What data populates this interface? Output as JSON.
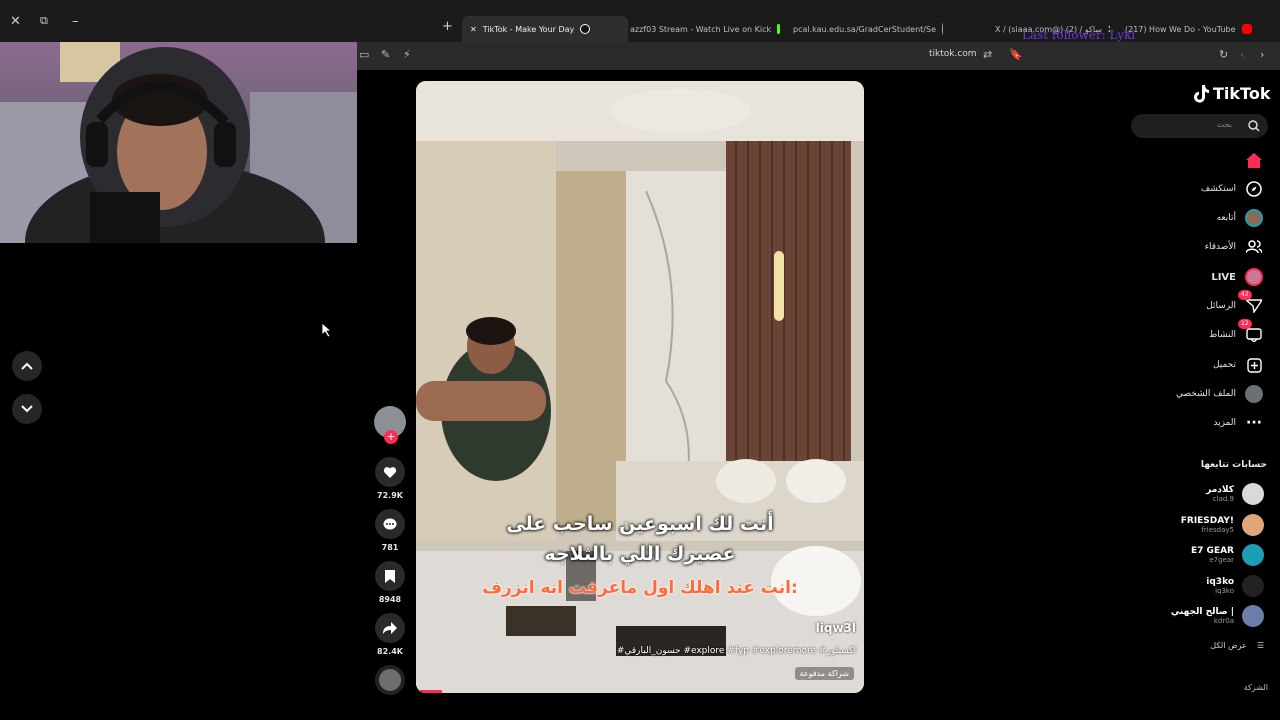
{
  "browser": {
    "tabs": [
      {
        "label": "TikTok - Make Your Day",
        "active": true
      },
      {
        "label": "azzf03 Stream - Watch Live on Kick",
        "active": false
      },
      {
        "label": "pcal.kau.edu.sa/GradCerStudent/Se",
        "active": false
      },
      {
        "label": "X / (siaaa.com@) ساكو / (2)",
        "active": false
      },
      {
        "label": "(217) How We Do - YouTube",
        "active": false
      }
    ],
    "url": "tiktok.com"
  },
  "overlay": {
    "text": "Last follower: Lyki"
  },
  "video": {
    "subtitle_line1": "أنت لك اسبوعين ساحب على",
    "subtitle_line2": "عصيرك اللي بالثلاجه",
    "subtitle_line3": "انت عند اهلك اول ماعرفت انه انزرف:",
    "handle": "liqw3l",
    "hashtags": "#حسون_البارقي #explore #fyp #exploremore #اكسبلور",
    "paid_partnership": "شراكة مدفوعة",
    "progress_fraction": 0.05
  },
  "actions": {
    "likes": "72.9K",
    "comments": "781",
    "saves": "8948",
    "shares": "82.4K"
  },
  "sidebar": {
    "brand": "TikTok",
    "search_placeholder": "بحث",
    "nav": [
      {
        "label": "",
        "icon": "home-icon"
      },
      {
        "label": "استكشف",
        "icon": "compass-icon"
      },
      {
        "label": "أتابعه",
        "icon": "avatar-icon"
      },
      {
        "label": "الأصدقاء",
        "icon": "friends-icon"
      },
      {
        "label": "LIVE",
        "icon": "live-icon"
      },
      {
        "label": "الرسائل",
        "icon": "messages-icon",
        "badge": "42"
      },
      {
        "label": "النشاط",
        "icon": "activity-icon",
        "badge": "12"
      },
      {
        "label": "تحميل",
        "icon": "upload-icon"
      },
      {
        "label": "الملف الشخصي",
        "icon": "profile-icon"
      },
      {
        "label": "المزيد",
        "icon": "more-icon"
      }
    ],
    "following_title": "حسابات تتابعها",
    "accounts": [
      {
        "name": "كلادمر",
        "handle": "clad.9",
        "color": "#d9d9d9"
      },
      {
        "name": "FRIESDAY!",
        "handle": "friesday5",
        "color": "#e0a67a"
      },
      {
        "name": "E7 GEAR",
        "handle": "e7gear",
        "color": "#1c9fb5"
      },
      {
        "name": "iq3ko",
        "handle": "iq3ko",
        "color": "#222222"
      },
      {
        "name": "صالح الجهني |",
        "handle": "kdr0a",
        "color": "#6d7fa8"
      }
    ],
    "see_all": "عرض الكل",
    "company": "الشركة"
  },
  "colors": {
    "accent": "#fe2c55",
    "background": "#000000"
  }
}
